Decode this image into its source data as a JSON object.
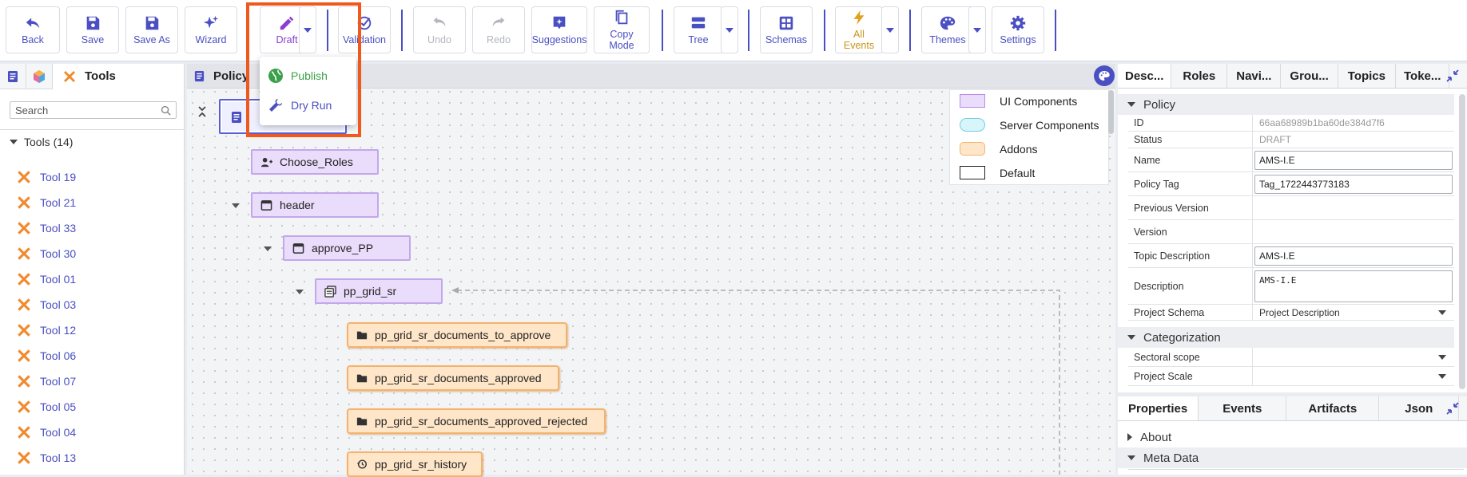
{
  "toolbar": {
    "back": "Back",
    "save": "Save",
    "save_as": "Save As",
    "wizard": "Wizard",
    "draft": "Draft",
    "validation": "Validation",
    "undo": "Undo",
    "redo": "Redo",
    "suggestions": "Suggestions",
    "copy_mode_1": "Copy",
    "copy_mode_2": "Mode",
    "tree": "Tree",
    "schemas": "Schemas",
    "all_events_1": "All",
    "all_events_2": "Events",
    "themes": "Themes",
    "settings": "Settings"
  },
  "draft_menu": {
    "publish": "Publish",
    "dry_run": "Dry Run"
  },
  "left_panel": {
    "title": "Tools",
    "search_placeholder": "Search",
    "category": "Tools (14)",
    "items": [
      "Tool 19",
      "Tool 21",
      "Tool 33",
      "Tool 30",
      "Tool 01",
      "Tool 03",
      "Tool 12",
      "Tool 06",
      "Tool 07",
      "Tool 05",
      "Tool 04",
      "Tool 13"
    ]
  },
  "canvas": {
    "title": "Policy",
    "nodes": {
      "choose_roles": "Choose_Roles",
      "header": "header",
      "approve_pp": "approve_PP",
      "pp_grid_sr": "pp_grid_sr",
      "docs_to_approve": "pp_grid_sr_documents_to_approve",
      "docs_approved": "pp_grid_sr_documents_approved",
      "docs_approved_rejected": "pp_grid_sr_documents_approved_rejected",
      "history": "pp_grid_sr_history"
    },
    "legend": {
      "ui": "UI Components",
      "server": "Server Components",
      "addons": "Addons",
      "default": "Default"
    }
  },
  "right_panel": {
    "tabs": [
      "Desc...",
      "Roles",
      "Navi...",
      "Grou...",
      "Topics",
      "Toke..."
    ],
    "policy_section": "Policy",
    "props": {
      "id_label": "ID",
      "id_value": "66aa68989b1ba60de384d7f6",
      "status_label": "Status",
      "status_value": "DRAFT",
      "name_label": "Name",
      "name_value": "AMS-I.E",
      "policy_tag_label": "Policy Tag",
      "policy_tag_value": "Tag_1722443773183",
      "prev_version_label": "Previous Version",
      "version_label": "Version",
      "topic_desc_label": "Topic Description",
      "topic_desc_value": "AMS-I.E",
      "description_label": "Description",
      "description_value": "AMS-I.E",
      "project_schema_label": "Project Schema",
      "project_schema_value": "Project Description"
    },
    "categorization_section": "Categorization",
    "sectoral_scope_label": "Sectoral scope",
    "project_scale_label": "Project Scale",
    "bottom_tabs": [
      "Properties",
      "Events",
      "Artifacts",
      "Json"
    ],
    "about": "About",
    "meta_data": "Meta Data"
  },
  "colors": {
    "accent": "#4a4fc2",
    "ui_component": "#eadcfb",
    "server_component": "#d8f5fa",
    "addon": "#ffe6c8",
    "highlight": "#f0591d",
    "publish_green": "#3aa14a"
  }
}
